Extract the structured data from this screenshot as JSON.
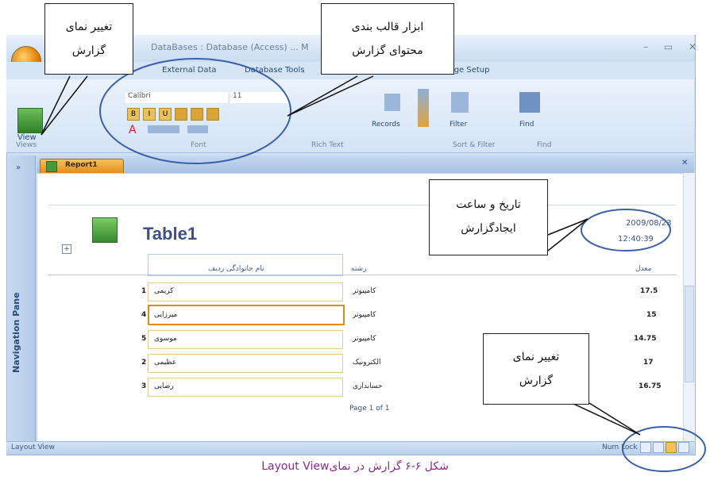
{
  "window": {
    "title": "DataBases : Database (Access) ... M",
    "controls": "– ▭ ✕"
  },
  "ribbon": {
    "tabs": [
      "External Data",
      "Database Tools",
      "Page Setup"
    ],
    "view_label": "View",
    "font_name": "Calibri",
    "font_size": "11",
    "format_buttons": [
      "B",
      "I",
      "U"
    ],
    "records_label": "Records",
    "filter_label": "Filter",
    "find_label": "Find",
    "groups": [
      "Views",
      "Font",
      "Rich Text",
      "Sort & Filter",
      "Find"
    ]
  },
  "document_tab": {
    "label": "Report1"
  },
  "navigation_pane": {
    "label": "Navigation Pane"
  },
  "report": {
    "title": "Table1",
    "date": "2009/08/23",
    "time": "12:40:39",
    "columns": {
      "name_header": "نام خانوادگی ردیف",
      "field_header": "رشته",
      "grade_header": "معدل"
    },
    "rows": [
      {
        "num": "1",
        "name": "کریمی",
        "field": "کامپیوتر",
        "grade": "17.5"
      },
      {
        "num": "4",
        "name": "میرزایی",
        "field": "کامپیوتر",
        "grade": "15"
      },
      {
        "num": "5",
        "name": "موسوی",
        "field": "کامپیوتر",
        "grade": "14.75"
      },
      {
        "num": "2",
        "name": "عظیمی",
        "field": "الکترونیک",
        "grade": "17"
      },
      {
        "num": "3",
        "name": "رضایی",
        "field": "حسابداری",
        "grade": "16.75"
      }
    ],
    "page_label": "Page 1 of 1"
  },
  "statusbar": {
    "left": "Layout View",
    "right": "Num Lock"
  },
  "annotations": {
    "change_view_top": [
      "تغییر  نمای",
      "گزارش"
    ],
    "format_tools": [
      "ابزار  قالب  بندی",
      "محتوای گزارش"
    ],
    "date_time": [
      "تاریخ  و  ساعت",
      "ایجادگزارش"
    ],
    "change_view_bottom": [
      "تغییر  نمای",
      "گزارش"
    ]
  },
  "caption": "شکل ۶-۶ گزارش در نمایLayout View"
}
